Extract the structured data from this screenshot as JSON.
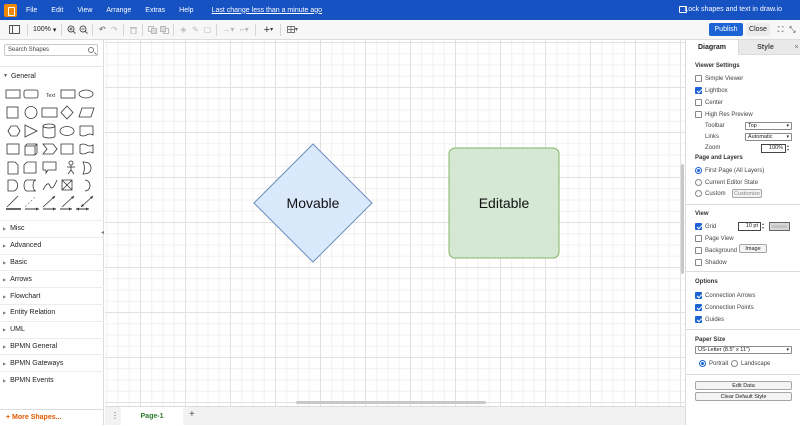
{
  "menubar": {
    "items": [
      "File",
      "Edit",
      "View",
      "Arrange",
      "Extras",
      "Help"
    ],
    "last_change": "Last change less than a minute ago",
    "doc_title": "Lock shapes and text in draw.io"
  },
  "toolbar": {
    "zoom": "100%",
    "publish_label": "Publish",
    "close_label": "Close"
  },
  "sidebar": {
    "search_placeholder": "Search Shapes",
    "general_label": "General",
    "text_shape_label": "Text",
    "categories": [
      "Misc",
      "Advanced",
      "Basic",
      "Arrows",
      "Flowchart",
      "Entity Relation",
      "UML",
      "BPMN General",
      "BPMN Gateways",
      "BPMN Events"
    ],
    "more_shapes": "+ More Shapes..."
  },
  "canvas": {
    "diamond_label": "Movable",
    "rect_label": "Editable",
    "diamond_fill": "#dae8fc",
    "diamond_stroke": "#6c8ebf",
    "rect_fill": "#d5e8d4",
    "rect_stroke": "#82b366"
  },
  "pagebar": {
    "page_tab": "Page-1"
  },
  "panel": {
    "tab_diagram": "Diagram",
    "tab_style": "Style",
    "viewer_settings": "Viewer Settings",
    "simple_viewer": "Simple Viewer",
    "lightbox": "Lightbox",
    "center": "Center",
    "high_res_preview": "High Res Preview",
    "toolbar_label": "Toolbar",
    "toolbar_value": "Top",
    "links_label": "Links",
    "links_value": "Automatic",
    "zoom_label": "Zoom",
    "zoom_value": "100%",
    "page_and_layers": "Page and Layers",
    "first_page": "First Page (All Layers)",
    "current_editor_state": "Current Editor State",
    "custom": "Custom",
    "customize": "Customize",
    "view": "View",
    "grid": "Grid",
    "grid_size": "10 pt",
    "page_view": "Page View",
    "background": "Background",
    "image": "Image",
    "shadow": "Shadow",
    "options": "Options",
    "connection_arrows": "Connection Arrows",
    "connection_points": "Connection Points",
    "guides": "Guides",
    "paper_size": "Paper Size",
    "paper_value": "US-Letter (8.5\" x 11\")",
    "portrait": "Portrait",
    "landscape": "Landscape",
    "edit_data": "Edit Data",
    "clear_default_style": "Clear Default Style"
  }
}
